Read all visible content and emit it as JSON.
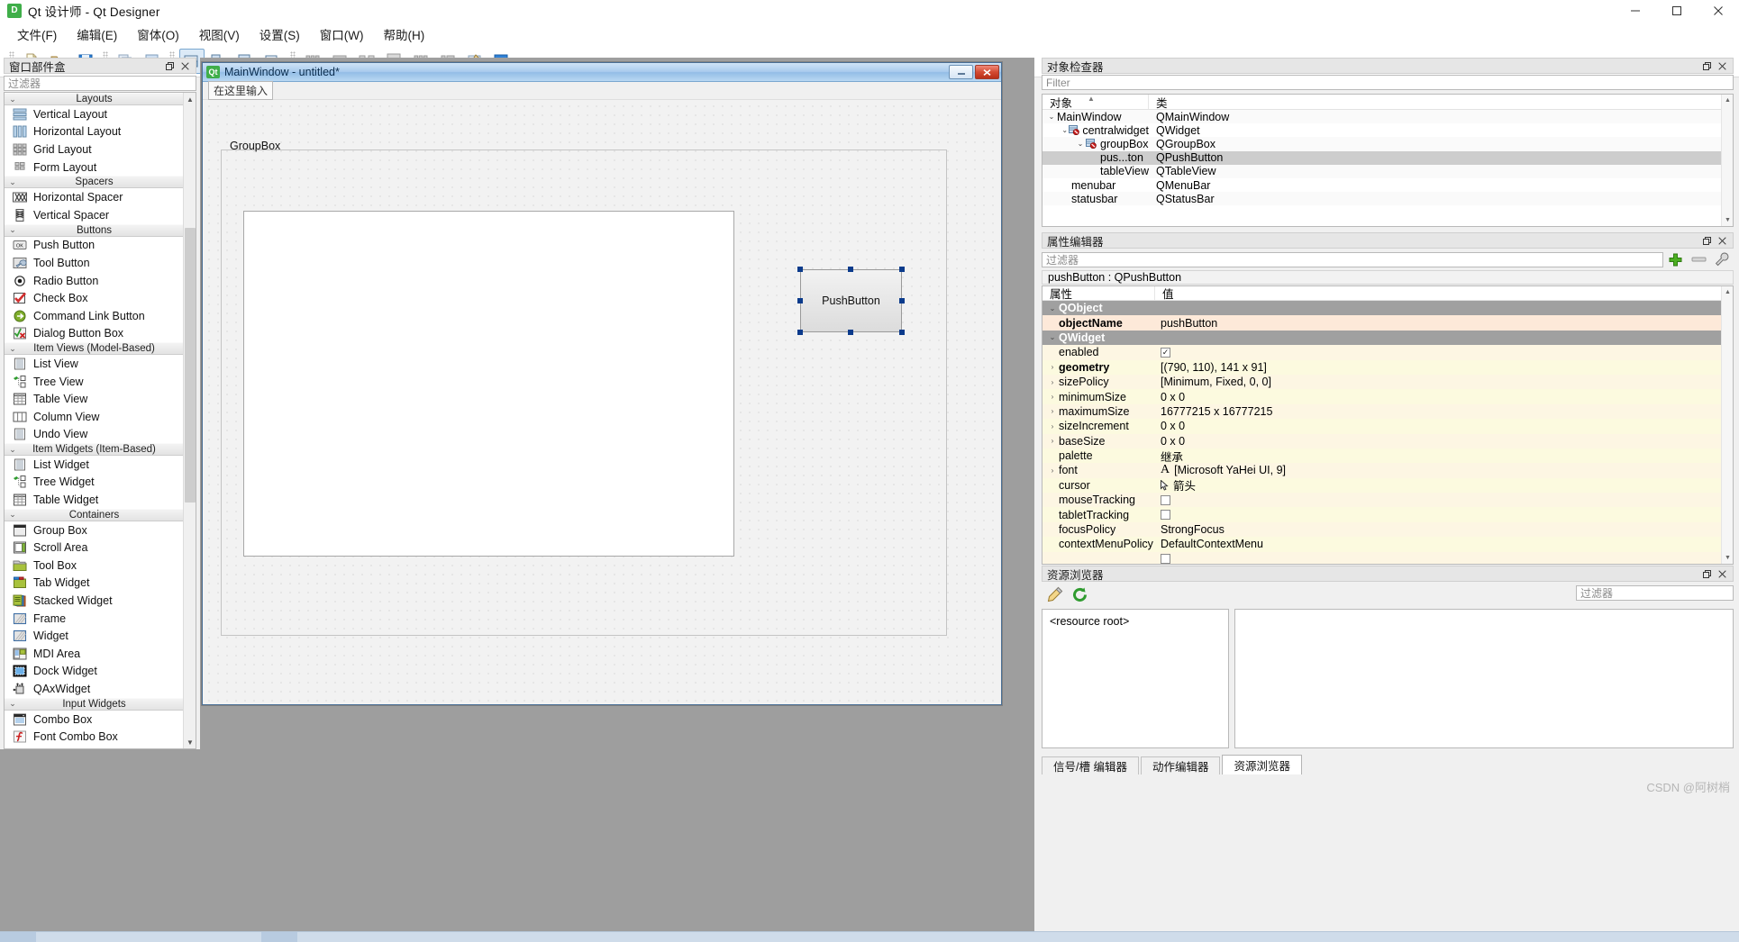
{
  "window": {
    "title": "Qt 设计师 - Qt Designer",
    "icon": "qt-logo-icon",
    "buttons": {
      "minimize": "—",
      "maximize": "▢",
      "close": "✕"
    }
  },
  "menubar": {
    "items": [
      {
        "label": "文件(F)",
        "name": "menu-file"
      },
      {
        "label": "编辑(E)",
        "name": "menu-edit"
      },
      {
        "label": "窗体(O)",
        "name": "menu-form"
      },
      {
        "label": "视图(V)",
        "name": "menu-view"
      },
      {
        "label": "设置(S)",
        "name": "menu-settings"
      },
      {
        "label": "窗口(W)",
        "name": "menu-window"
      },
      {
        "label": "帮助(H)",
        "name": "menu-help"
      }
    ]
  },
  "toolbar": {
    "groups": [
      {
        "buttons": [
          {
            "name": "new-form-button",
            "icon": "new-file-icon"
          },
          {
            "name": "open-form-button",
            "icon": "open-folder-icon"
          },
          {
            "name": "save-form-button",
            "icon": "save-disk-icon"
          }
        ]
      },
      {
        "buttons": [
          {
            "name": "undo-button",
            "icon": "copy-icon"
          },
          {
            "name": "redo-button",
            "icon": "paste-icon"
          }
        ]
      },
      {
        "buttons": [
          {
            "name": "edit-widgets-button",
            "icon": "edit-widgets-icon",
            "active": true
          },
          {
            "name": "edit-signals-slots-button",
            "icon": "signals-slots-icon"
          },
          {
            "name": "edit-buddies-button",
            "icon": "buddies-icon"
          },
          {
            "name": "edit-tab-order-button",
            "icon": "tab-order-icon"
          }
        ]
      },
      {
        "buttons": [
          {
            "name": "layout-horizontally-button",
            "icon": "layout-horizontal-icon"
          },
          {
            "name": "layout-vertically-button",
            "icon": "layout-vertical-icon"
          },
          {
            "name": "layout-splitter-h-button",
            "icon": "splitter-horizontal-icon"
          },
          {
            "name": "layout-splitter-v-button",
            "icon": "splitter-vertical-icon"
          },
          {
            "name": "layout-grid-button",
            "icon": "layout-grid-icon"
          },
          {
            "name": "layout-form-button",
            "icon": "layout-form-icon"
          },
          {
            "name": "break-layout-button",
            "icon": "break-layout-icon"
          },
          {
            "name": "adjust-size-button",
            "icon": "adjust-size-icon"
          }
        ]
      }
    ]
  },
  "widget_box": {
    "title": "窗口部件盒",
    "filter_placeholder": "过滤器",
    "float_button": "float-icon",
    "close_button": "close-icon",
    "groups": [
      {
        "name": "Layouts",
        "items": [
          {
            "label": "Vertical Layout",
            "icon": "vertical-layout-icon"
          },
          {
            "label": "Horizontal Layout",
            "icon": "horizontal-layout-icon"
          },
          {
            "label": "Grid Layout",
            "icon": "grid-layout-icon"
          },
          {
            "label": "Form Layout",
            "icon": "form-layout-icon"
          }
        ]
      },
      {
        "name": "Spacers",
        "items": [
          {
            "label": "Horizontal Spacer",
            "icon": "horizontal-spacer-icon"
          },
          {
            "label": "Vertical Spacer",
            "icon": "vertical-spacer-icon"
          }
        ]
      },
      {
        "name": "Buttons",
        "items": [
          {
            "label": "Push Button",
            "icon": "push-button-icon"
          },
          {
            "label": "Tool Button",
            "icon": "tool-button-icon"
          },
          {
            "label": "Radio Button",
            "icon": "radio-button-icon"
          },
          {
            "label": "Check Box",
            "icon": "check-box-icon"
          },
          {
            "label": "Command Link Button",
            "icon": "command-link-icon"
          },
          {
            "label": "Dialog Button Box",
            "icon": "dialog-button-box-icon"
          }
        ]
      },
      {
        "name": "Item Views (Model-Based)",
        "items": [
          {
            "label": "List View",
            "icon": "list-view-icon"
          },
          {
            "label": "Tree View",
            "icon": "tree-view-icon"
          },
          {
            "label": "Table View",
            "icon": "table-view-icon"
          },
          {
            "label": "Column View",
            "icon": "column-view-icon"
          },
          {
            "label": "Undo View",
            "icon": "undo-view-icon"
          }
        ]
      },
      {
        "name": "Item Widgets (Item-Based)",
        "items": [
          {
            "label": "List Widget",
            "icon": "list-widget-icon"
          },
          {
            "label": "Tree Widget",
            "icon": "tree-widget-icon"
          },
          {
            "label": "Table Widget",
            "icon": "table-widget-icon"
          }
        ]
      },
      {
        "name": "Containers",
        "items": [
          {
            "label": "Group Box",
            "icon": "group-box-icon"
          },
          {
            "label": "Scroll Area",
            "icon": "scroll-area-icon"
          },
          {
            "label": "Tool Box",
            "icon": "tool-box-icon"
          },
          {
            "label": "Tab Widget",
            "icon": "tab-widget-icon"
          },
          {
            "label": "Stacked Widget",
            "icon": "stacked-widget-icon"
          },
          {
            "label": "Frame",
            "icon": "frame-icon"
          },
          {
            "label": "Widget",
            "icon": "widget-icon"
          },
          {
            "label": "MDI Area",
            "icon": "mdi-area-icon"
          },
          {
            "label": "Dock Widget",
            "icon": "dock-widget-icon"
          },
          {
            "label": "QAxWidget",
            "icon": "qax-widget-icon"
          }
        ]
      },
      {
        "name": "Input Widgets",
        "items": [
          {
            "label": "Combo Box",
            "icon": "combo-box-icon"
          },
          {
            "label": "Font Combo Box",
            "icon": "font-combo-box-icon"
          }
        ]
      }
    ]
  },
  "form": {
    "title": "MainWindow - untitled*",
    "icon": "qt-logo-icon",
    "minimize_label": "—",
    "close_label": "✕",
    "menu_hint": "在这里输入",
    "groupbox_label": "GroupBox",
    "pushbutton_label": "PushButton"
  },
  "object_inspector": {
    "title": "对象检查器",
    "filter_placeholder": "Filter",
    "columns": [
      "对象",
      "类"
    ],
    "rows": [
      {
        "name": "MainWindow",
        "class": "QMainWindow",
        "depth": 0,
        "expander": true,
        "icon": null,
        "selected": false
      },
      {
        "name": "centralwidget",
        "class": "QWidget",
        "depth": 1,
        "expander": true,
        "icon": "widget-disabled-icon",
        "selected": false
      },
      {
        "name": "groupBox",
        "class": "QGroupBox",
        "depth": 2,
        "expander": true,
        "icon": "widget-disabled-icon",
        "selected": false
      },
      {
        "name": "pus...ton",
        "class": "QPushButton",
        "depth": 3,
        "expander": false,
        "icon": null,
        "selected": true
      },
      {
        "name": "tableView",
        "class": "QTableView",
        "depth": 3,
        "expander": false,
        "icon": null,
        "selected": false
      },
      {
        "name": "menubar",
        "class": "QMenuBar",
        "depth": 1,
        "expander": false,
        "icon": null,
        "selected": false
      },
      {
        "name": "statusbar",
        "class": "QStatusBar",
        "depth": 1,
        "expander": false,
        "icon": null,
        "selected": false
      }
    ]
  },
  "property_editor": {
    "title": "属性编辑器",
    "filter_placeholder": "过滤器",
    "add_button_icon": "plus-icon",
    "remove_button_icon": "minus-icon",
    "configure_button_icon": "wrench-icon",
    "object_line": "pushButton : QPushButton",
    "columns": [
      "属性",
      "值"
    ],
    "rows": [
      {
        "kind": "group",
        "key": "QObject",
        "value": "",
        "expander": true
      },
      {
        "kind": "orange",
        "key": "objectName",
        "value": "pushButton",
        "bold": true,
        "expander": false
      },
      {
        "kind": "group",
        "key": "QWidget",
        "value": "",
        "expander": true
      },
      {
        "kind": "y0",
        "key": "enabled",
        "value": "",
        "checkbox": "checked",
        "expander": false
      },
      {
        "kind": "y1",
        "key": "geometry",
        "value": "[(790, 110), 141 x 91]",
        "bold": true,
        "expander": true
      },
      {
        "kind": "y0",
        "key": "sizePolicy",
        "value": "[Minimum, Fixed, 0, 0]",
        "expander": true
      },
      {
        "kind": "y1",
        "key": "minimumSize",
        "value": "0 x 0",
        "expander": true
      },
      {
        "kind": "y0",
        "key": "maximumSize",
        "value": "16777215 x 16777215",
        "expander": true
      },
      {
        "kind": "y1",
        "key": "sizeIncrement",
        "value": "0 x 0",
        "expander": true
      },
      {
        "kind": "y0",
        "key": "baseSize",
        "value": "0 x 0",
        "expander": true
      },
      {
        "kind": "y1",
        "key": "palette",
        "value": "继承",
        "expander": false
      },
      {
        "kind": "y0",
        "key": "font",
        "value": "[Microsoft YaHei UI, 9]",
        "icon": "font-A-icon",
        "expander": true
      },
      {
        "kind": "y1",
        "key": "cursor",
        "value": "箭头",
        "icon": "arrow-cursor-icon",
        "expander": false
      },
      {
        "kind": "y0",
        "key": "mouseTracking",
        "value": "",
        "checkbox": "unchecked",
        "expander": false
      },
      {
        "kind": "y1",
        "key": "tabletTracking",
        "value": "",
        "checkbox": "unchecked",
        "expander": false
      },
      {
        "kind": "y0",
        "key": "focusPolicy",
        "value": "StrongFocus",
        "expander": false
      },
      {
        "kind": "y1",
        "key": "contextMenuPolicy",
        "value": "DefaultContextMenu",
        "expander": false
      },
      {
        "kind": "y0",
        "key": "",
        "value": "",
        "checkbox": "unchecked",
        "expander": false
      }
    ]
  },
  "resource_browser": {
    "title": "资源浏览器",
    "edit_icon": "pencil-icon",
    "reload_icon": "reload-icon",
    "filter_placeholder": "过滤器",
    "tree_root": "<resource root>",
    "tabs": [
      {
        "label": "信号/槽 编辑器",
        "active": false
      },
      {
        "label": "动作编辑器",
        "active": false
      },
      {
        "label": "资源浏览器",
        "active": true
      }
    ]
  },
  "watermark": "CSDN @阿树梢",
  "colors": {
    "accent": "#3fae49",
    "title_gradient_start": "#cfe3f6",
    "selection": "#0b3b8c",
    "property_group": "#a0a0a0",
    "property_yellow": "#fdf6e3",
    "property_orange": "#fde9d9"
  }
}
